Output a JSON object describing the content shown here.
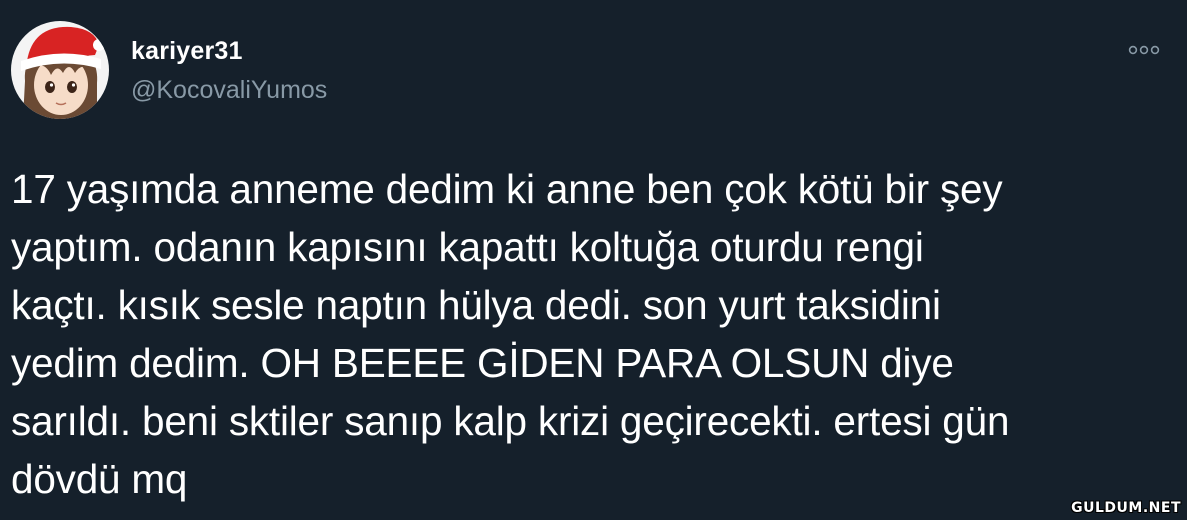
{
  "user": {
    "display_name": "kariyer31",
    "handle": "@KocovaliYumos"
  },
  "more_icon": "more-horizontal-icon",
  "tweet": {
    "text": "17 yaşımda anneme dedim ki anne ben çok kötü bir şey\nyaptım. odanın kapısını kapattı koltuğa oturdu rengi\nkaçtı. kısık sesle naptın hülya dedi. son yurt taksidini\nyedim dedim. OH BEEEE GİDEN PARA OLSUN diye\nsarıldı. beni sktiler sanıp kalp krizi geçirecekti. ertesi gün\ndövdü mq"
  },
  "watermark": "GULDUM.NET",
  "colors": {
    "background": "#15202b",
    "text": "#ffffff",
    "secondary_text": "#8899a6"
  }
}
